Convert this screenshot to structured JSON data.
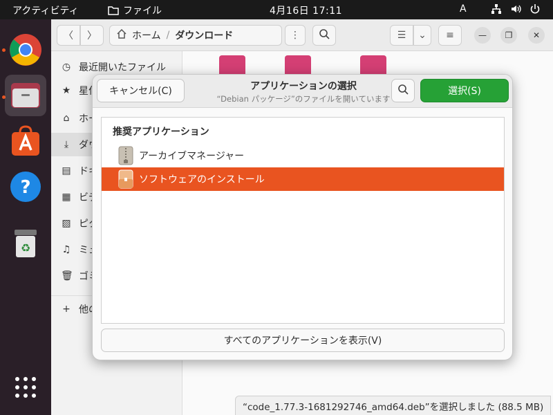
{
  "topbar": {
    "activities": "アクティビティ",
    "app_menu_label": "ファイル",
    "clock": "4月16日  17:11",
    "input_source": "A"
  },
  "dock": {
    "items": [
      "chrome-icon",
      "files-icon",
      "app-center-icon",
      "help-icon",
      "trash-icon",
      "show-apps-icon"
    ]
  },
  "files": {
    "path": {
      "home": "ホーム",
      "separator": "/",
      "current": "ダウンロード"
    },
    "sidebar": {
      "items": [
        {
          "icon": "clock-icon",
          "label": "最近開いたファイル"
        },
        {
          "icon": "star-icon",
          "label": "星付き"
        },
        {
          "icon": "home-icon",
          "label": "ホーム"
        },
        {
          "icon": "download-icon",
          "label": "ダウンロード"
        },
        {
          "icon": "document-icon",
          "label": "ドキュメント"
        },
        {
          "icon": "video-icon",
          "label": "ビデオ"
        },
        {
          "icon": "picture-icon",
          "label": "ピクチャ"
        },
        {
          "icon": "music-icon",
          "label": "ミュージック"
        },
        {
          "icon": "trash-icon",
          "label": "ゴミ箱"
        },
        {
          "icon": "plus-icon",
          "label": "他の場所"
        }
      ]
    },
    "status": "“code_1.77.3-1681292746_amd64.deb”を選択しました (88.5 MB)"
  },
  "dialog": {
    "cancel_label": "キャンセル(C)",
    "title": "アプリケーションの選択",
    "subtitle": "“Debian パッケージ”のファイルを開いています",
    "select_label": "選択(S)",
    "list_heading": "推奨アプリケーション",
    "apps": [
      {
        "label": "アーカイブマネージャー",
        "selected": false
      },
      {
        "label": "ソフトウェアのインストール",
        "selected": true
      }
    ],
    "show_all_label": "すべてのアプリケーションを表示(V)"
  },
  "colors": {
    "accent": "#e95420",
    "select_button": "#26a136"
  }
}
